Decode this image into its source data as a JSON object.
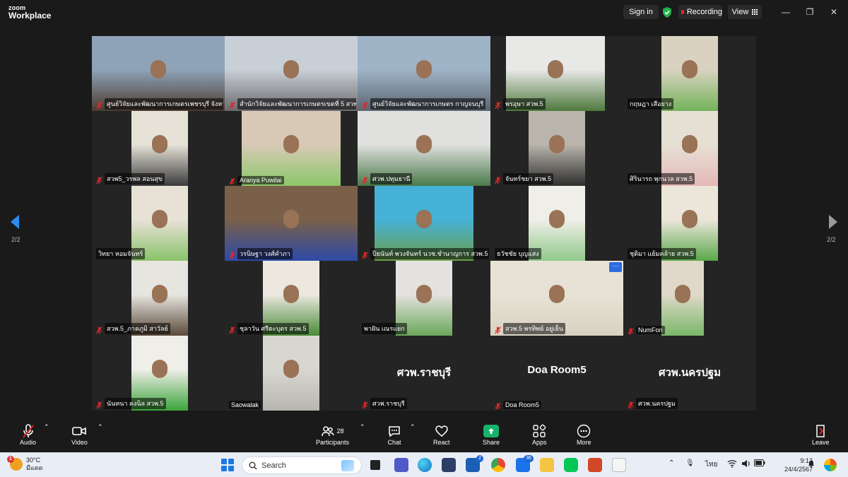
{
  "app": {
    "logo_line1": "zoom",
    "logo_line2": "Workplace"
  },
  "topbar": {
    "signin_label": "Sign in",
    "recording_label": "Recording",
    "view_label": "View"
  },
  "window_controls": {
    "minimize": "—",
    "restore": "❐",
    "close": "✕"
  },
  "navigation": {
    "page_left": "2/2",
    "page_right": "2/2"
  },
  "participants": [
    {
      "name": "ศูนย์วิจัยและพัฒนาการเกษตรเพชรบุรี จังหวั",
      "muted": true
    },
    {
      "name": "สำนักวิจัยและพัฒนาการเกษตรเขตที่ 5 สวพ.5",
      "muted": true
    },
    {
      "name": "ศูนย์วิจัยและพัฒนาการเกษตร กาญจนบุรี",
      "muted": true
    },
    {
      "name": "พรอุษา สวพ.5",
      "muted": true
    },
    {
      "name": "กฤษฎา เสือยาง",
      "muted": false
    },
    {
      "name": "สวพ5_วรพล สอนสุข",
      "muted": true
    },
    {
      "name": "Aranya Puwilai",
      "muted": true
    },
    {
      "name": "ศวพ.ปทุมธานี",
      "muted": true
    },
    {
      "name": "จันทร์ชยา สวพ.5",
      "muted": true
    },
    {
      "name": "ศิรินารถ พุกนวล สวพ.5",
      "muted": false
    },
    {
      "name": "วิทยา หอมจันทร์",
      "muted": false
    },
    {
      "name": "วรนิษฐา วงศ์คำภา",
      "muted": true
    },
    {
      "name": "ปิยนันท์ พวงจันทร์ นวช.ชำนาญการ สวพ.5",
      "muted": true
    },
    {
      "name": "ธวัชชัย บุญแสง",
      "muted": false
    },
    {
      "name": "ชุติมา แย้มคล้าย สวพ.5",
      "muted": false
    },
    {
      "name": "สวพ.5_ภาคภูมิ สาวัลย์",
      "muted": true
    },
    {
      "name": "ชุลาวัน ศรีตะบุตร สวพ.5",
      "muted": true
    },
    {
      "name": "พาฝัน เณรแยก",
      "muted": false
    },
    {
      "name": "สวพ.5 พรทิพย์ อยู่เย็น",
      "muted": true
    },
    {
      "name": "NumFon",
      "muted": true
    },
    {
      "name": "นันทนา คงนิล สวพ.5",
      "muted": true
    },
    {
      "name": "Saowalak",
      "muted": false
    },
    {
      "name": "ศวพ.ราชบุรี",
      "muted": true,
      "display_name": "ศวพ.ราชบุรี"
    },
    {
      "name": "Doa Room5",
      "muted": true,
      "display_name": "Doa Room5"
    },
    {
      "name": "ศวพ.นครปฐม",
      "muted": true,
      "display_name": "ศวพ.นครปฐม"
    }
  ],
  "toolbar": {
    "audio": "Audio",
    "video": "Video",
    "participants": "Participants",
    "participants_count": "28",
    "chat": "Chat",
    "react": "React",
    "share": "Share",
    "apps": "Apps",
    "more": "More",
    "leave": "Leave"
  },
  "taskbar": {
    "temperature": "30°C",
    "weather": "มีแดด",
    "weather_badge": "1",
    "search_label": "Search",
    "teams_badge": "2",
    "mail_badge": "36",
    "lang": "ไทย",
    "time": "9:12",
    "date": "24/4/2567"
  },
  "colors": {
    "active_speaker": "#2dd27a",
    "accent_blue": "#2d8cf0",
    "share_green": "#16b36b",
    "recording_red": "#e02828"
  }
}
